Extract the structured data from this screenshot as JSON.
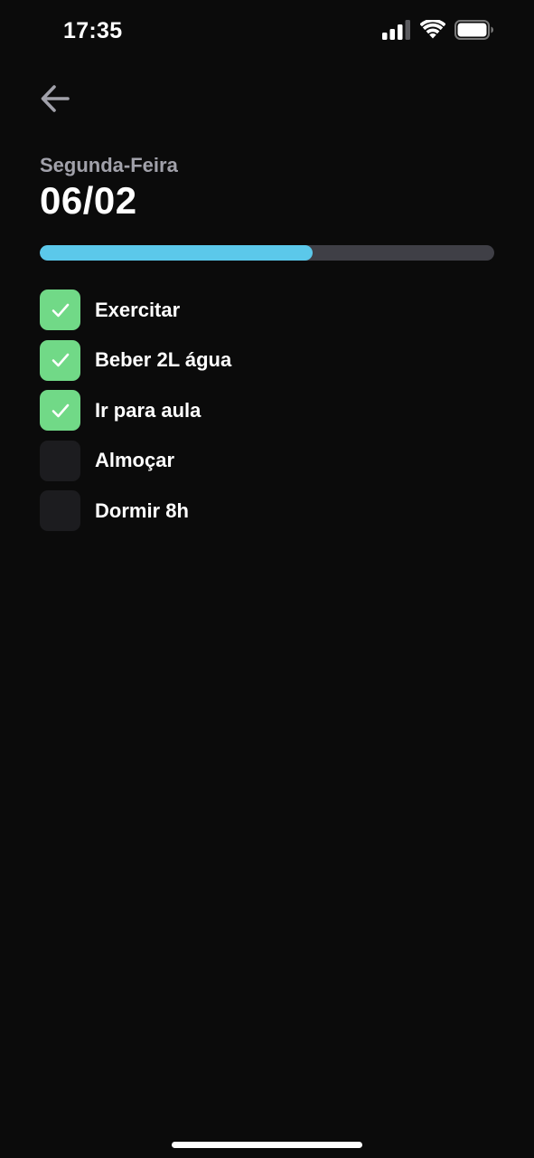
{
  "status_bar": {
    "time": "17:35",
    "icons": [
      "cellular-signal-icon",
      "wifi-icon",
      "battery-icon"
    ]
  },
  "header": {
    "back_icon": "arrow-left-icon",
    "weekday": "Segunda-Feira",
    "date": "06/02"
  },
  "progress": {
    "fraction": 0.6,
    "fill_color": "#5bc8ea",
    "track_color": "#3f3f46"
  },
  "tasks": [
    {
      "label": "Exercitar",
      "checked": true
    },
    {
      "label": "Beber 2L água",
      "checked": true
    },
    {
      "label": "Ir para aula",
      "checked": true
    },
    {
      "label": "Almoçar",
      "checked": false
    },
    {
      "label": "Dormir 8h",
      "checked": false
    }
  ],
  "colors": {
    "background": "#0b0b0b",
    "checked": "#71d987",
    "unchecked": "#1c1c1f",
    "muted_text": "#a1a1aa"
  }
}
